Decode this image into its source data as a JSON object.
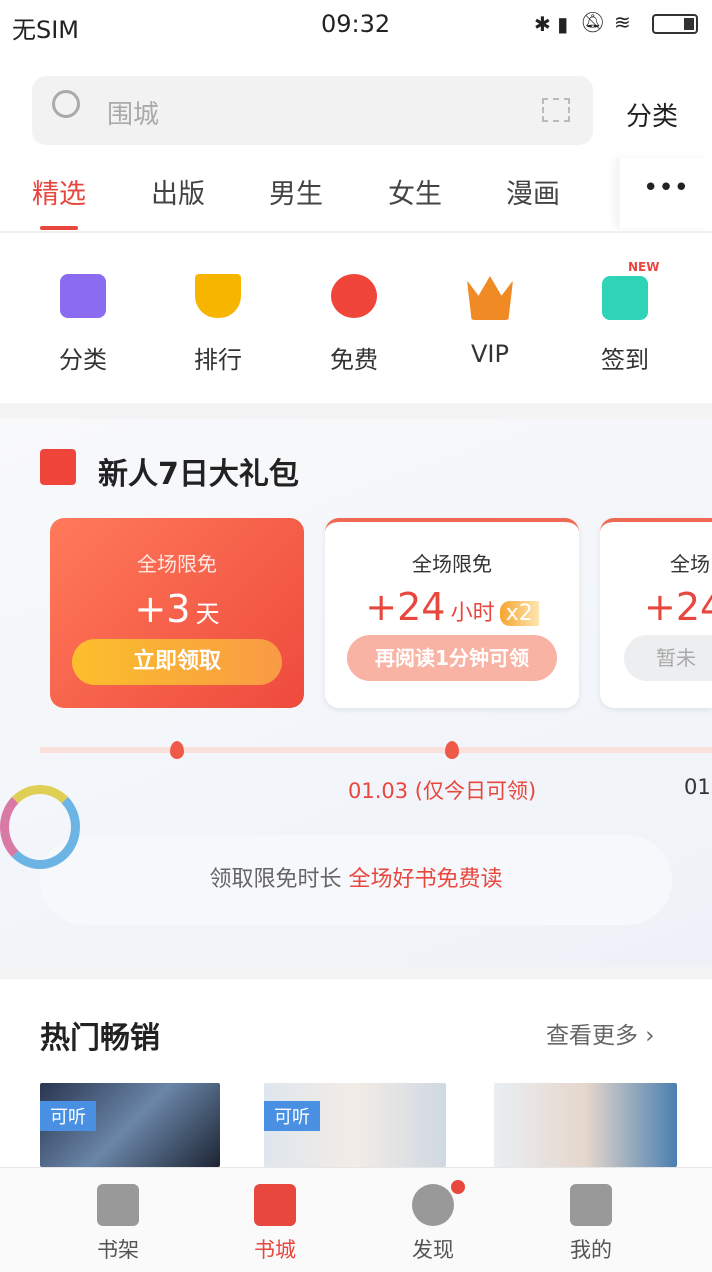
{
  "status_bar": {
    "carrier": "无SIM",
    "time": "09:32"
  },
  "search": {
    "placeholder": "围城",
    "category_label": "分类"
  },
  "tabs": [
    {
      "label": "精选",
      "active": true
    },
    {
      "label": "出版"
    },
    {
      "label": "男生"
    },
    {
      "label": "女生"
    },
    {
      "label": "漫画"
    }
  ],
  "quick_links": [
    {
      "label": "分类",
      "icon": "category-icon",
      "color": "#8b6cf0"
    },
    {
      "label": "排行",
      "icon": "trophy-icon",
      "color": "#f7b500"
    },
    {
      "label": "免费",
      "icon": "free-icon",
      "color": "#f0453a"
    },
    {
      "label": "VIP",
      "icon": "crown-icon",
      "color": "#f08a24"
    },
    {
      "label": "签到",
      "icon": "checkin-calendar-icon",
      "color": "#2fd3b6",
      "badge": "NEW"
    }
  ],
  "gift": {
    "title": "新人7日大礼包",
    "cards": [
      {
        "title": "全场限免",
        "amount": "+3",
        "unit": "天",
        "button": "立即领取"
      },
      {
        "title": "全场限免",
        "amount": "+24",
        "unit": "小时",
        "multiplier": "x2",
        "button": "再阅读1分钟可领",
        "date": "01.03 (仅今日可领)"
      },
      {
        "title": "全场",
        "amount": "+24",
        "button": "暂未",
        "date": "01"
      }
    ],
    "banner_text": "领取限免时长",
    "banner_highlight": "全场好书免费读"
  },
  "hot": {
    "title": "热门畅销",
    "more": "查看更多",
    "books": [
      {
        "tag": "可听"
      },
      {
        "tag": "可听"
      },
      {}
    ]
  },
  "bottom_nav": [
    {
      "label": "书架",
      "icon": "bookshelf-icon"
    },
    {
      "label": "书城",
      "icon": "bookstore-icon",
      "active": true
    },
    {
      "label": "发现",
      "icon": "compass-icon",
      "dot": true
    },
    {
      "label": "我的",
      "icon": "profile-icon"
    }
  ],
  "colors": {
    "accent": "#e8473e"
  }
}
